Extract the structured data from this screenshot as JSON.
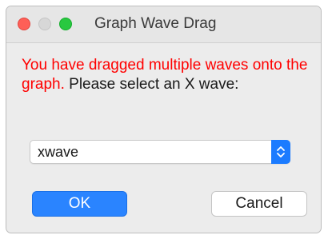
{
  "window": {
    "title": "Graph Wave Drag"
  },
  "message": {
    "warning_text": "You have dragged multiple waves onto the graph.",
    "prompt_text": " Please select an X wave:",
    "warning_color": "#ff0000"
  },
  "x_wave_select": {
    "selected": "xwave",
    "icon": "chevron-updown-icon"
  },
  "buttons": {
    "ok_label": "OK",
    "cancel_label": "Cancel"
  },
  "colors": {
    "accent": "#2a84ff",
    "close": "#fe5f57",
    "zoom": "#28c840"
  }
}
